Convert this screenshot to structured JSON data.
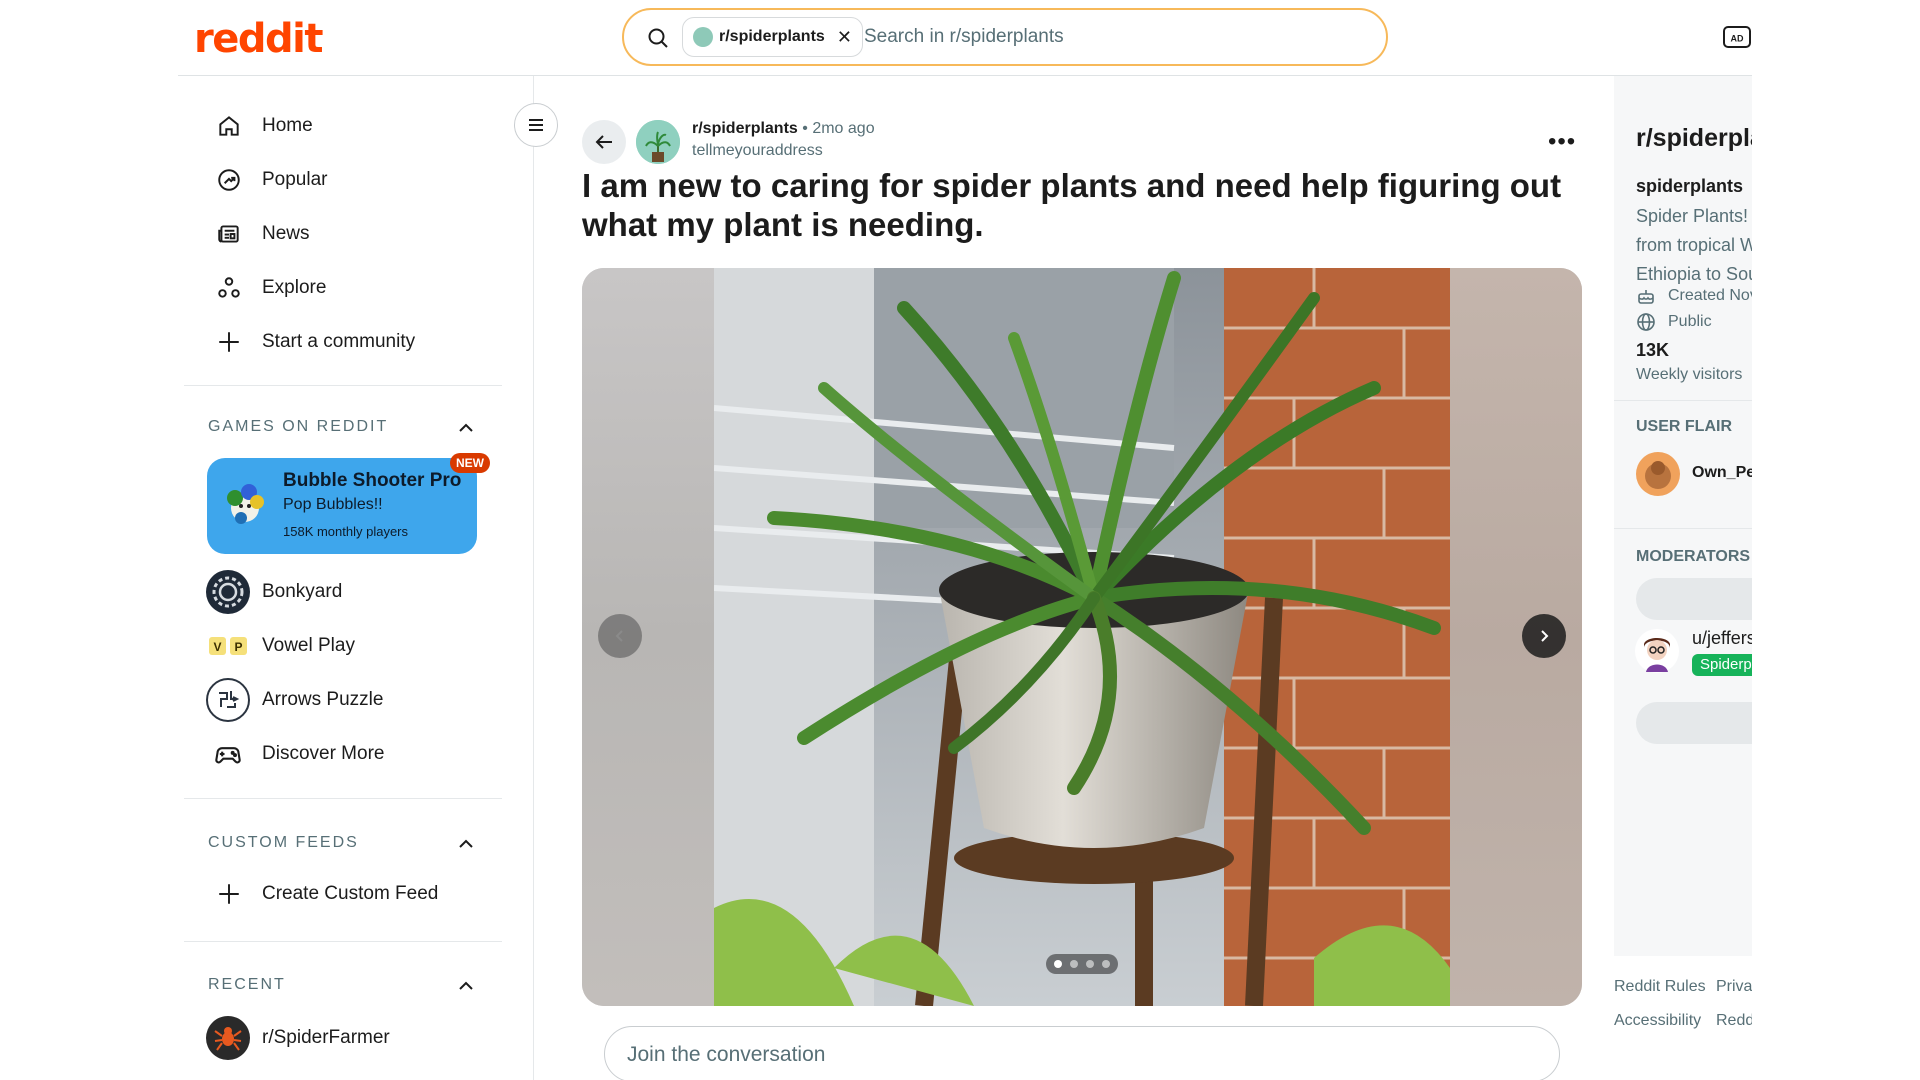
{
  "brand": {
    "logo_text": "reddit",
    "accent": "#ff4500"
  },
  "search": {
    "chip_label": "r/spiderplants",
    "chip_close": "✕",
    "placeholder": "Search in r/spiderplants"
  },
  "header": {
    "ad_icon": "advertise-icon"
  },
  "sidebar": {
    "nav": [
      {
        "label": "Home",
        "icon": "home-icon"
      },
      {
        "label": "Popular",
        "icon": "popular-icon"
      },
      {
        "label": "News",
        "icon": "news-icon"
      },
      {
        "label": "Explore",
        "icon": "explore-icon"
      },
      {
        "label": "Start a community",
        "icon": "plus-icon"
      }
    ],
    "games_title": "GAMES ON REDDIT",
    "featured_game": {
      "title": "Bubble Shooter Pro",
      "subtitle": "Pop Bubbles!!",
      "players": "158K monthly players",
      "badge": "NEW"
    },
    "games": [
      {
        "label": "Bonkyard",
        "icon": "bonkyard-icon"
      },
      {
        "label": "Vowel Play",
        "icon": "vowel-play-icon"
      },
      {
        "label": "Arrows Puzzle",
        "icon": "arrows-puzzle-icon"
      },
      {
        "label": "Discover More",
        "icon": "gamepad-icon"
      }
    ],
    "custom_feeds_title": "CUSTOM FEEDS",
    "create_feed_label": "Create Custom Feed",
    "recent_title": "RECENT",
    "recent": [
      {
        "label": "r/SpiderFarmer",
        "icon": "spiderfarmer-avatar"
      }
    ]
  },
  "post": {
    "subreddit": "r/spiderplants",
    "separator": "•",
    "time": "2mo ago",
    "author": "tellmeyouraddress",
    "more": "•••",
    "title": "I am new to caring for spider plants and need help figuring out what my plant is needing.",
    "gallery": {
      "current": 1,
      "total": 4
    },
    "comment_placeholder": "Join the conversation"
  },
  "right": {
    "title": "r/spiderplants",
    "name": "spiderplants",
    "desc_lines": [
      "Spider Plants!",
      "from tropical W",
      "Ethiopia to Sou"
    ],
    "created": "Created Nov",
    "visibility": "Public",
    "weekly_visitors_value": "13K",
    "weekly_visitors_label": "Weekly visitors",
    "user_flair_title": "USER FLAIR",
    "flair_user": "Own_Pers",
    "moderators_title": "MODERATORS",
    "mod_name": "u/jefferso",
    "mod_flair": "Spiderpl"
  },
  "footer": {
    "links": [
      "Reddit Rules",
      "Privac",
      "Accessibility",
      "Reddi"
    ]
  }
}
